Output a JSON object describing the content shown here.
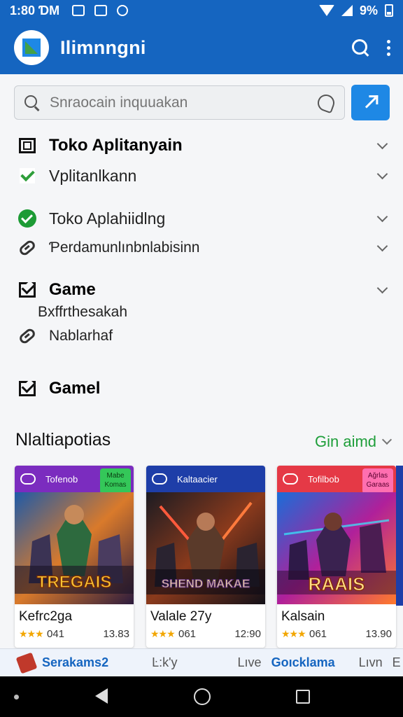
{
  "status": {
    "time": "1:80 ƊM",
    "battery": "9%"
  },
  "appbar": {
    "title": "Ilimnngni"
  },
  "search": {
    "placeholder": "Snraocain inquuakan"
  },
  "menu": [
    {
      "label": "Toko Aplitanyain",
      "style": "bold"
    },
    {
      "label": "Vplitanlkann",
      "style": "normal"
    },
    {
      "label": "Toko Aplahiidlng",
      "style": "normal"
    },
    {
      "label": "Ƥerdamunlınbnlabisinn",
      "style": "small"
    },
    {
      "label": "Game",
      "style": "bold"
    },
    {
      "label": "Bxffrthesakah",
      "style": "small"
    },
    {
      "label": "Nablarhaf",
      "style": "small"
    },
    {
      "label": "Gamel",
      "style": "bold"
    }
  ],
  "section": {
    "title": "Nlaltiapotias",
    "link": "Gin aimd"
  },
  "cards": [
    {
      "banner": "Tofenob",
      "tag": "Mabe\nKomas",
      "art_title": "TREGAIS",
      "name": "Kefrc2ga",
      "stars": "★★★",
      "rating": "041",
      "size": "13.83",
      "banner_color": "#7b2cbf",
      "tag_color": "#34c759"
    },
    {
      "banner": "Kaltaacier",
      "tag": "",
      "art_title": "SHEND MAKAE",
      "name": "Valale 27y",
      "stars": "★★★",
      "rating": "061",
      "size": "12:90",
      "banner_color": "#1e3ea8",
      "tag_color": ""
    },
    {
      "banner": "Tofilbob",
      "tag": "Ağrlas\nGaraas",
      "art_title": "RAAIS",
      "name": "Kalsain",
      "stars": "★★★",
      "rating": "061",
      "size": "13.90",
      "banner_color": "#e53946",
      "tag_color": "#ff6fb0"
    }
  ],
  "bottom_tabs": [
    "Serakams2",
    "Ŀ:k'y",
    "Lıve",
    "Goıcklama",
    "Lıvn",
    "E"
  ],
  "colors": {
    "primary": "#1565c0",
    "accent": "#1e88e5",
    "green": "#1e9e3a"
  }
}
